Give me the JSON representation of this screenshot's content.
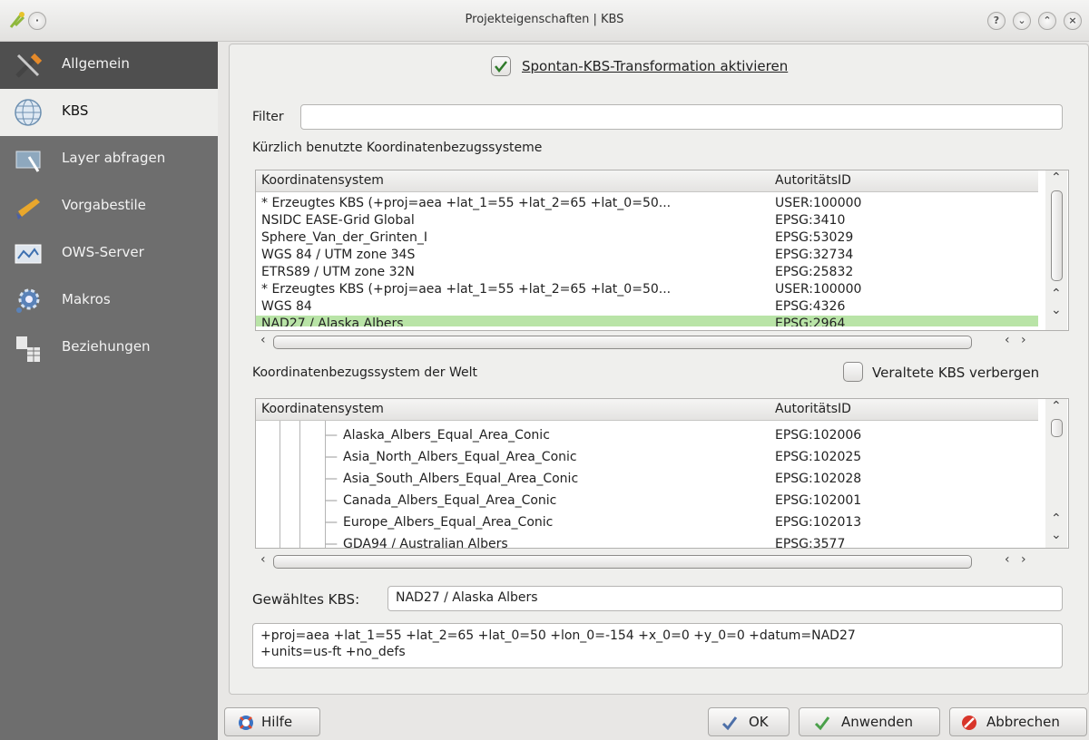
{
  "window": {
    "title": "Projekteigenschaften | KBS"
  },
  "sidebar": {
    "items": [
      {
        "label": "Allgemein"
      },
      {
        "label": "KBS"
      },
      {
        "label": "Layer abfragen"
      },
      {
        "label": "Vorgabestile"
      },
      {
        "label": "OWS-Server"
      },
      {
        "label": "Makros"
      },
      {
        "label": "Beziehungen"
      }
    ]
  },
  "top": {
    "transform_label": "Spontan-KBS-Transformation aktivieren",
    "transform_checked": true
  },
  "filter": {
    "label": "Filter",
    "value": ""
  },
  "recent": {
    "heading": "Kürzlich benutzte Koordinatenbezugssysteme",
    "col_name": "Koordinatensystem",
    "col_id": "AutoritätsID",
    "rows": [
      {
        "name": " * Erzeugtes KBS (+proj=aea +lat_1=55 +lat_2=65 +lat_0=50...",
        "id": "USER:100000"
      },
      {
        "name": "NSIDC EASE-Grid Global",
        "id": "EPSG:3410"
      },
      {
        "name": "Sphere_Van_der_Grinten_I",
        "id": "EPSG:53029"
      },
      {
        "name": "WGS 84 / UTM zone 34S",
        "id": "EPSG:32734"
      },
      {
        "name": "ETRS89 / UTM zone 32N",
        "id": "EPSG:25832"
      },
      {
        "name": " * Erzeugtes KBS (+proj=aea +lat_1=55 +lat_2=65 +lat_0=50...",
        "id": "USER:100000"
      },
      {
        "name": "WGS 84",
        "id": "EPSG:4326"
      },
      {
        "name": "NAD27 / Alaska Albers",
        "id": "EPSG:2964"
      }
    ]
  },
  "world": {
    "heading": "Koordinatenbezugssystem der Welt",
    "hide_label": "Veraltete KBS verbergen",
    "col_name": "Koordinatensystem",
    "col_id": "AutoritätsID",
    "rows": [
      {
        "name": "Alaska_Albers_Equal_Area_Conic",
        "id": "EPSG:102006"
      },
      {
        "name": "Asia_North_Albers_Equal_Area_Conic",
        "id": "EPSG:102025"
      },
      {
        "name": "Asia_South_Albers_Equal_Area_Conic",
        "id": "EPSG:102028"
      },
      {
        "name": "Canada_Albers_Equal_Area_Conic",
        "id": "EPSG:102001"
      },
      {
        "name": "Europe_Albers_Equal_Area_Conic",
        "id": "EPSG:102013"
      },
      {
        "name": "GDA94 / Australian Albers",
        "id": "EPSG:3577"
      }
    ]
  },
  "selected": {
    "label": "Gewähltes KBS:",
    "value": "NAD27 / Alaska Albers"
  },
  "proj": {
    "line1": "+proj=aea +lat_1=55 +lat_2=65 +lat_0=50 +lon_0=-154 +x_0=0 +y_0=0 +datum=NAD27",
    "line2": "+units=us-ft +no_defs"
  },
  "buttons": {
    "help": "Hilfe",
    "ok": "OK",
    "apply": "Anwenden",
    "cancel": "Abbrechen"
  },
  "colors": {
    "selection": "#b9e4a7",
    "sidebar": "#6e6e6e",
    "sidebar_active": "#eeeeec"
  }
}
